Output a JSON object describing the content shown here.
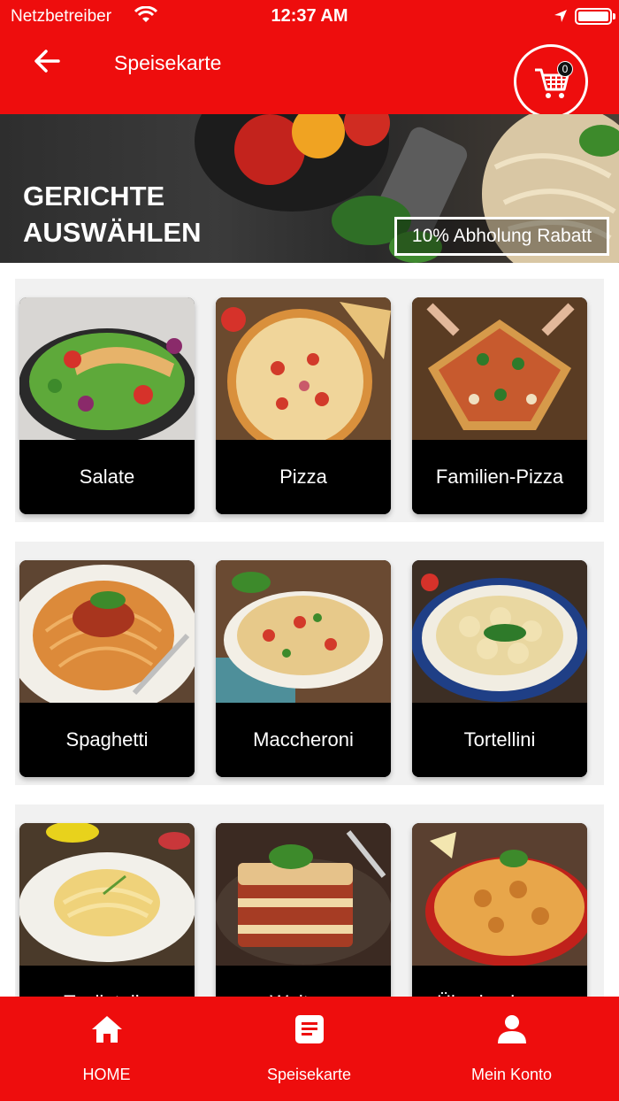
{
  "status_bar": {
    "carrier": "Netzbetreiber",
    "time": "12:37 AM"
  },
  "header": {
    "title": "Speisekarte",
    "cart_count": "0"
  },
  "banner": {
    "title_line1": "GERICHTE",
    "title_line2": "AUSWÄHLEN",
    "promo": "10% Abholung Rabatt"
  },
  "categories": [
    {
      "label": "Salate"
    },
    {
      "label": "Pizza"
    },
    {
      "label": "Familien-Pizza"
    },
    {
      "label": "Spaghetti"
    },
    {
      "label": "Maccheroni"
    },
    {
      "label": "Tortellini"
    },
    {
      "label": "Tagliatelle"
    },
    {
      "label": "Weitere"
    },
    {
      "label": "Überbackenes"
    }
  ],
  "bottom_nav": [
    {
      "label": "HOME",
      "icon": "home-icon"
    },
    {
      "label": "Speisekarte",
      "icon": "menu-document-icon"
    },
    {
      "label": "Mein Konto",
      "icon": "user-icon"
    }
  ],
  "colors": {
    "primary": "#ee0d0d",
    "card_label_bg": "#000000",
    "text_on_primary": "#ffffff"
  }
}
